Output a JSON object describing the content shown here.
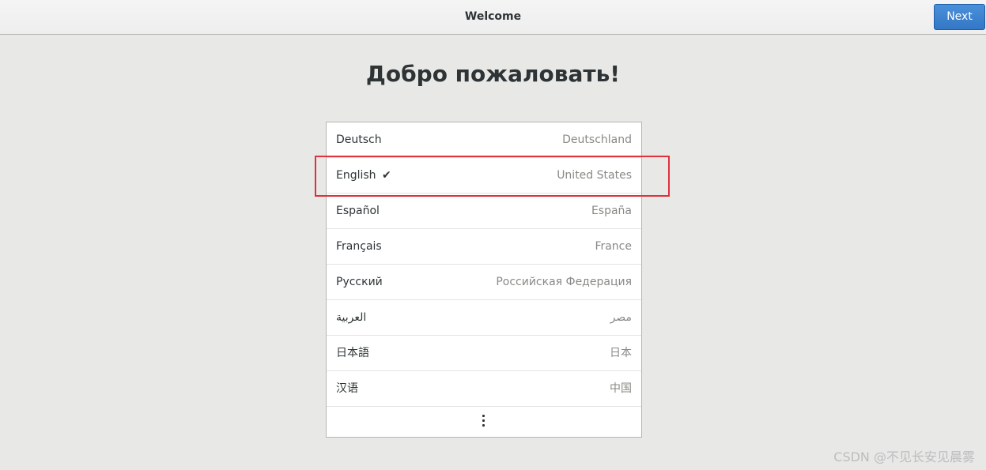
{
  "header": {
    "title": "Welcome",
    "next_label": "Next"
  },
  "welcome": {
    "heading": "Добро пожаловать!"
  },
  "languages": [
    {
      "name": "Deutsch",
      "region": "Deutschland",
      "selected": false
    },
    {
      "name": "English",
      "region": "United States",
      "selected": true
    },
    {
      "name": "Español",
      "region": "España",
      "selected": false
    },
    {
      "name": "Français",
      "region": "France",
      "selected": false
    },
    {
      "name": "Русский",
      "region": "Российская Федерация",
      "selected": false
    },
    {
      "name": "العربية",
      "region": "مصر",
      "selected": false
    },
    {
      "name": "日本語",
      "region": "日本",
      "selected": false
    },
    {
      "name": "汉语",
      "region": "中国",
      "selected": false
    }
  ],
  "icons": {
    "selected": "check-icon",
    "more": "more-vertical-icon"
  },
  "watermark": "CSDN @不见长安见晨雾",
  "colors": {
    "accent": "#3a83d0",
    "highlight": "#e0313c",
    "background": "#e8e8e7"
  }
}
